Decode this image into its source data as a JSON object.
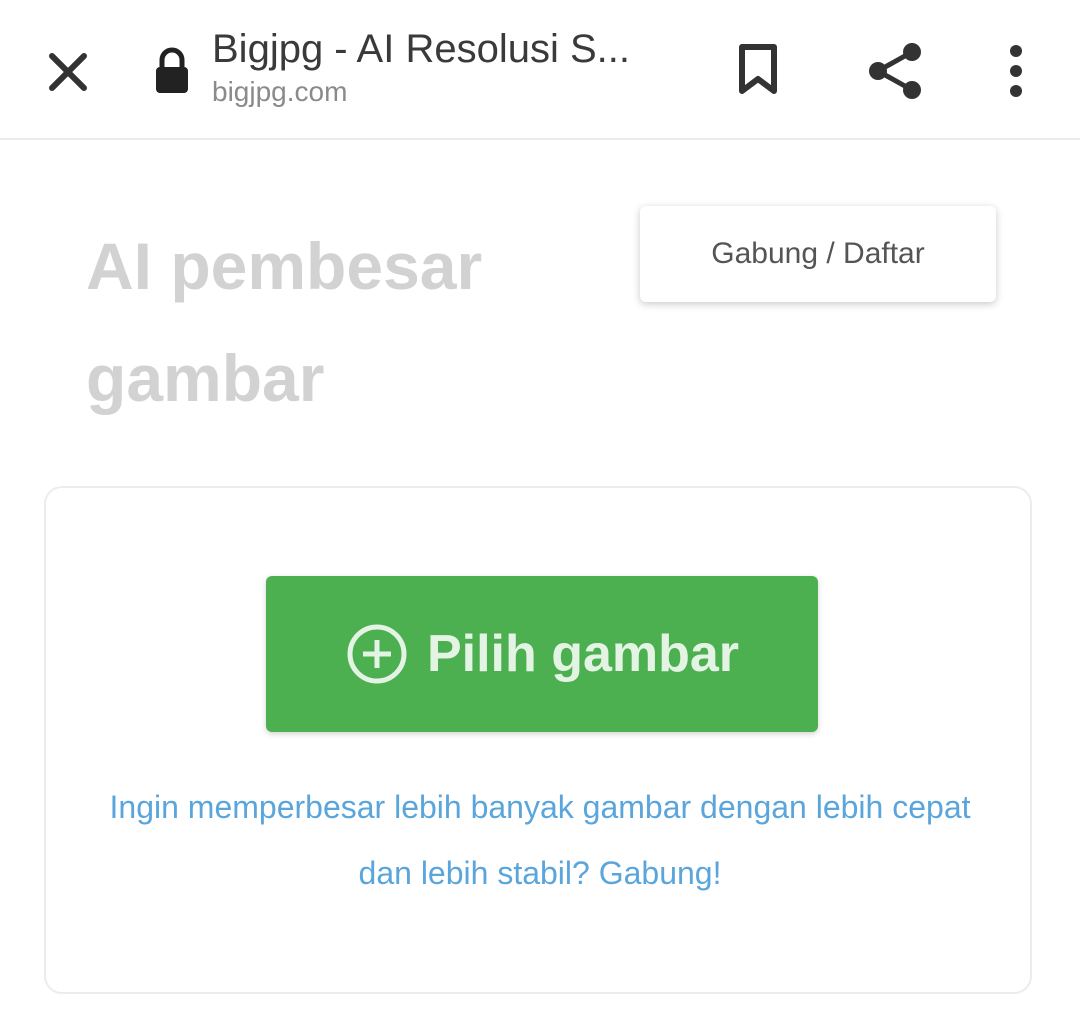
{
  "browser": {
    "title": "Bigjpg - AI Resolusi S...",
    "url": "bigjpg.com",
    "icons": {
      "close": "close-icon",
      "lock": "lock-icon",
      "bookmark": "bookmark-icon",
      "share": "share-icon",
      "menu": "more-vert-icon"
    }
  },
  "header": {
    "title": "AI pembesar gambar",
    "login_label": "Gabung / Daftar"
  },
  "upload": {
    "button_label": "Pilih gambar",
    "button_icon": "plus-circle-icon",
    "promo_text": "Ingin memperbesar lebih banyak gambar dengan lebih cepat dan lebih stabil? Gabung!"
  },
  "colors": {
    "accent_green": "#4caf50",
    "link_blue": "#5aa6dc",
    "title_grey": "#d2d2d2"
  }
}
